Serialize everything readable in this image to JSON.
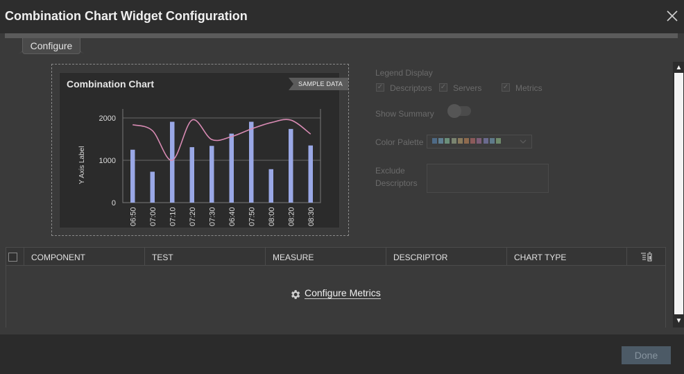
{
  "window": {
    "title": "Combination Chart Widget Configuration"
  },
  "tabs": [
    {
      "label": "Configure"
    }
  ],
  "preview": {
    "title": "Combination Chart",
    "badge": "SAMPLE DATA"
  },
  "chart_data": {
    "type": "bar",
    "title": "Combination Chart",
    "ylabel": "Y Axis Label",
    "xlabel": "",
    "ylim": [
      0,
      2000
    ],
    "yticks": [
      "0",
      "1000",
      "2000"
    ],
    "categories": [
      "06:50",
      "07:00",
      "07:10",
      "07:20",
      "07:30",
      "06:40",
      "07:50",
      "08:00",
      "08:20",
      "08:30"
    ],
    "series": [
      {
        "type": "bar",
        "color": "#9aa8e6",
        "values": [
          1250,
          730,
          1910,
          1310,
          1340,
          1630,
          1910,
          790,
          1740,
          1350
        ]
      },
      {
        "type": "line",
        "color": "#d98bb4",
        "values": [
          1840,
          1700,
          1000,
          1950,
          1490,
          1560,
          1740,
          1890,
          1950,
          1620
        ]
      }
    ],
    "grid": true
  },
  "settings": {
    "legend_display_label": "Legend Display",
    "legend_options": [
      {
        "label": "Descriptors",
        "checked": true
      },
      {
        "label": "Servers",
        "checked": true
      },
      {
        "label": "Metrics",
        "checked": true
      }
    ],
    "show_summary_label": "Show Summary",
    "color_palette_label": "Color Palette",
    "palette_colors": [
      "#4e6a86",
      "#5f7f91",
      "#6b8f7a",
      "#7a8470",
      "#8a7a5c",
      "#8e6a4e",
      "#8b5a5a",
      "#7d5d78",
      "#6a6a8e",
      "#5f7a8a",
      "#6f8a6b"
    ],
    "exclude_label_line1": "Exclude",
    "exclude_label_line2": "Descriptors"
  },
  "table": {
    "columns": [
      "COMPONENT",
      "TEST",
      "MEASURE",
      "DESCRIPTOR",
      "CHART TYPE"
    ],
    "configure_link": "Configure Metrics"
  },
  "footer": {
    "done_label": "Done"
  },
  "colors": {
    "accent_bar": "#9aa8e6",
    "accent_line": "#d98bb4",
    "done_button": "#4c5a66"
  }
}
